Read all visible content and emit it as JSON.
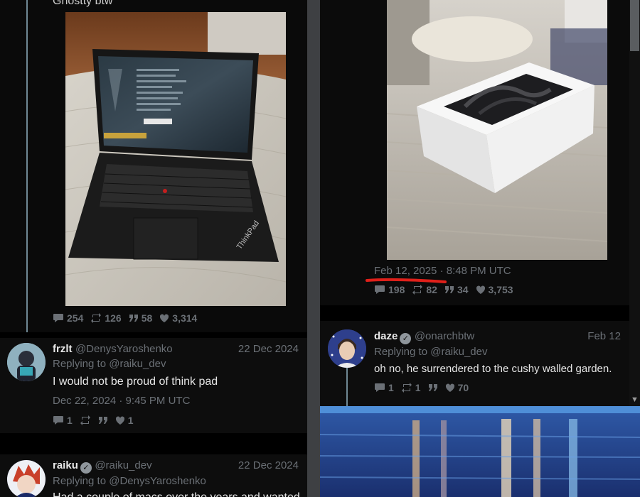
{
  "left": {
    "top_text": "Ghostty btw",
    "post_stats": {
      "replies": "254",
      "reposts": "126",
      "quotes": "58",
      "likes": "3,314"
    },
    "reply1": {
      "name": "frzlt",
      "handle": "@DenysYaroshenko",
      "date": "22 Dec 2024",
      "replying_prefix": "Replying to",
      "replying_handle": "@raiku_dev",
      "text": "I would not be proud of think pad",
      "timestamp": "Dec 22, 2024 · 9:45 PM UTC",
      "stats": {
        "replies": "1",
        "reposts": "",
        "quotes": "",
        "likes": "1"
      }
    },
    "reply2": {
      "name": "raiku",
      "handle": "@raiku_dev",
      "date": "22 Dec 2024",
      "replying_prefix": "Replying to",
      "replying_handle": "@DenysYaroshenko",
      "text": "Had a couple of macs over the years and wanted"
    }
  },
  "right": {
    "timestamp_date": "Feb 12, 2025",
    "timestamp_time": "· 8:48 PM UTC",
    "post_stats": {
      "replies": "198",
      "reposts": "82",
      "quotes": "34",
      "likes": "3,753"
    },
    "reply": {
      "name": "daze",
      "handle": "@onarchbtw",
      "date": "Feb 12",
      "replying_prefix": "Replying to",
      "replying_handle": "@raiku_dev",
      "text": "oh no, he surrendered to the cushy walled garden.",
      "stats": {
        "replies": "1",
        "reposts": "1",
        "quotes": "",
        "likes": "70"
      }
    },
    "annotation_color": "#e0201a"
  },
  "icons": [
    "comment-icon",
    "repost-icon",
    "quote-icon",
    "heart-icon",
    "verified-icon",
    "scroll-down-arrow-icon"
  ]
}
